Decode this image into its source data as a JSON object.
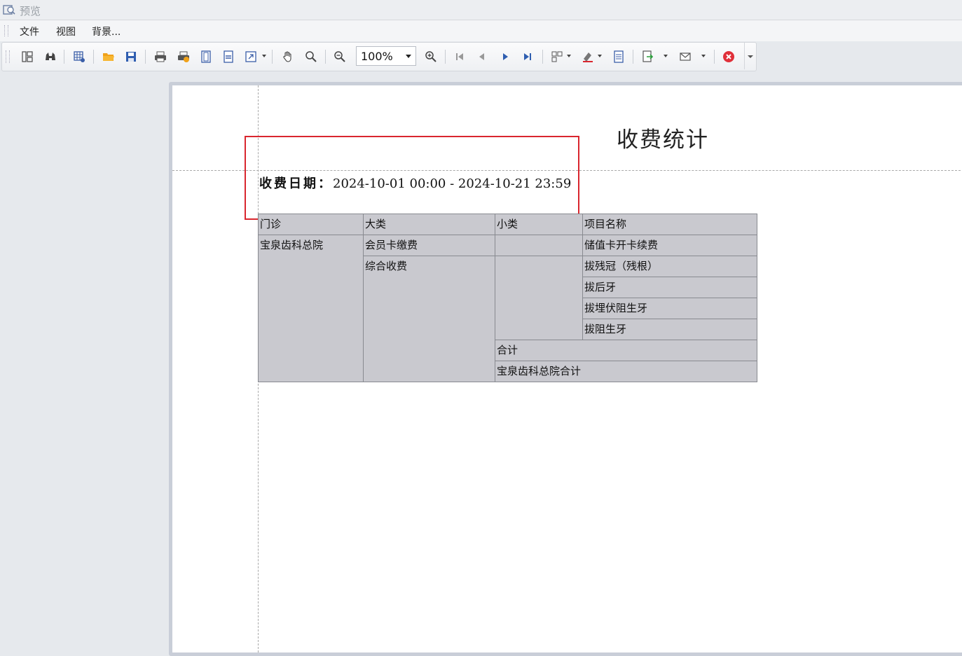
{
  "window": {
    "title": "预览"
  },
  "menu": [
    "文件",
    "视图",
    "背景..."
  ],
  "toolbar": {
    "zoom_value": "100%",
    "icons": [
      "layout-icon",
      "binoculars-icon",
      "grid-settings-icon",
      "open-folder-icon",
      "save-icon",
      "print-icon",
      "quick-print-icon",
      "page-setup-icon",
      "header-footer-icon",
      "scale-icon",
      "hand-tool-icon",
      "magnifier-icon",
      "zoom-out-icon",
      "zoom-in-icon",
      "first-page-icon",
      "prev-page-icon",
      "next-page-icon",
      "last-page-icon",
      "multipage-icon",
      "color-icon",
      "watermark-icon",
      "export-icon",
      "email-icon",
      "close-preview-icon"
    ]
  },
  "report": {
    "title": "收费统计",
    "date_label": "收费日期：",
    "date_range": "2024-10-01 00:00 - 2024-10-21 23:59",
    "highlight_color": "#d9262e",
    "headers": {
      "clinic": "门诊",
      "category": "大类",
      "subcategory": "小类",
      "item_name": "项目名称"
    },
    "clinic": "宝泉齿科总院",
    "categories": {
      "membership": "会员卡缴费",
      "general": "综合收费"
    },
    "items": {
      "membership_item": "储值卡开卡续费",
      "general_items": [
        "拔残冠（残根）",
        "拔后牙",
        "拔埋伏阻生牙",
        "拔阻生牙"
      ]
    },
    "subtotal_label": "合计",
    "grand_total_label": "宝泉齿科总院合计"
  }
}
